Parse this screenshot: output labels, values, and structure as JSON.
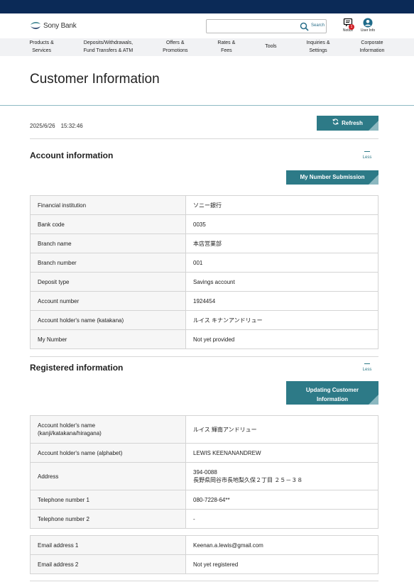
{
  "header": {
    "logo_text": "Sony Bank",
    "search": {
      "placeholder": "",
      "label": "Search"
    },
    "notice": {
      "label": "Notice",
      "badge": "1"
    },
    "user": {
      "label": "User Info"
    }
  },
  "nav": {
    "items": [
      {
        "label": "Products &\nServices"
      },
      {
        "label": "Deposits/Withdrawals,\nFund Transfers & ATM"
      },
      {
        "label": "Offers &\nPromotions"
      },
      {
        "label": "Rates &\nFees"
      },
      {
        "label": "Tools"
      },
      {
        "label": "Inquiries &\nSettings"
      },
      {
        "label": "Corporate\nInformation"
      }
    ]
  },
  "page": {
    "title": "Customer Information",
    "timestamp": "2025/6/26　15:32:46",
    "refresh_label": "Refresh"
  },
  "account": {
    "title": "Account information",
    "less_label": "Less",
    "button_label": "My Number Submission",
    "rows": [
      {
        "key": "Financial institution",
        "value": "ソニー銀行"
      },
      {
        "key": "Bank code",
        "value": "0035"
      },
      {
        "key": "Branch name",
        "value": "本店営業部"
      },
      {
        "key": "Branch number",
        "value": "001"
      },
      {
        "key": "Deposit type",
        "value": "Savings account"
      },
      {
        "key": "Account number",
        "value": "1924454"
      },
      {
        "key": "Account holder's name (katakana)",
        "value": "ルイス キナンアンドリュー"
      },
      {
        "key": "My Number",
        "value": "Not yet provided"
      }
    ]
  },
  "registered": {
    "title": "Registered information",
    "less_label": "Less",
    "button_label": "Updating Customer\nInformation",
    "rows": [
      {
        "key": "Account holder's name\n(kanji/katakana/hiragana)",
        "value": "ルイス 輝南アンドリュー"
      },
      {
        "key": "Account holder's name (alphabet)",
        "value": "LEWIS KEENANANDREW"
      },
      {
        "key": "Address",
        "value": "394-0088\n長野県岡谷市長地梨久保２丁目 ２５－３８"
      },
      {
        "key": "Telephone number 1",
        "value": "080-7228-64**"
      },
      {
        "key": "Telephone number 2",
        "value": "-"
      }
    ],
    "email_rows": [
      {
        "key": "Email address 1",
        "value": "Keenan.a.lewis@gmail.com"
      },
      {
        "key": "Email address 2",
        "value": "Not yet registered"
      }
    ]
  },
  "colors": {
    "navy": "#0b2a57",
    "teal": "#2d7a87",
    "badge_red": "#d21f26"
  }
}
